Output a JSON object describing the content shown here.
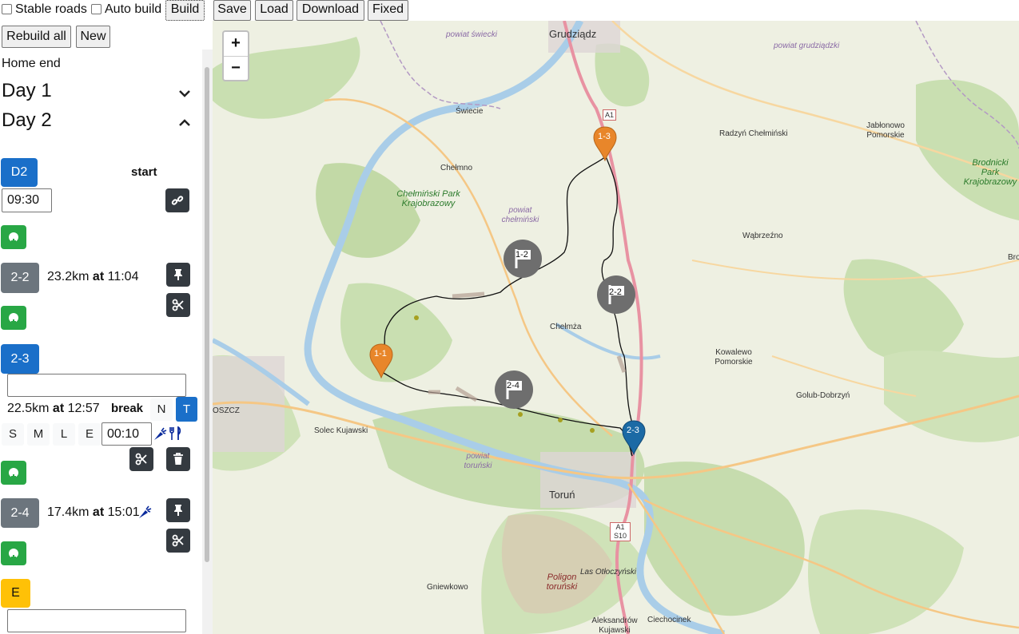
{
  "toolbar": {
    "stable_roads_label": "Stable roads",
    "auto_build_label": "Auto build",
    "build_label": "Build",
    "save_label": "Save",
    "load_label": "Load",
    "download_label": "Download",
    "fixed_label": "Fixed",
    "rebuild_all_label": "Rebuild all",
    "new_label": "New"
  },
  "sidebar": {
    "home_end": "Home end",
    "day1_title": "Day 1",
    "day2_title": "Day 2",
    "start": {
      "code": "D2",
      "label": "start",
      "time": "09:30"
    },
    "stops": [
      {
        "code": "2-2",
        "distance": "23.2km",
        "at": "at",
        "time": "11:04"
      },
      {
        "code": "2-3",
        "distance": "22.5km",
        "at": "at",
        "time": "12:57",
        "break_label": "break",
        "break_time": "00:10",
        "name_value": ""
      },
      {
        "code": "2-4",
        "distance": "17.4km",
        "at": "at",
        "time": "15:01"
      }
    ],
    "sizes": [
      "N",
      "T"
    ],
    "meal_sizes": [
      "S",
      "M",
      "L",
      "E"
    ],
    "end": {
      "code": "E",
      "name_value": ""
    }
  },
  "map": {
    "zoom_in": "+",
    "zoom_out": "−",
    "markers": [
      "1-3",
      "1-1",
      "2-3"
    ],
    "flags": [
      "1-2",
      "2-2",
      "2-4"
    ],
    "places": [
      "Grudziądz",
      "powiat świecki",
      "powiat grudziądzki",
      "Świecie",
      "A1",
      "Radzyń Chełmiński",
      "Jabłonowo Pomorskie",
      "Brodnicki Park Krajobrazowy",
      "Chełmno",
      "Chełmiński Park Krajobrazowy",
      "powiat chełmiński",
      "Wąbrzeźno",
      "Chełmża",
      "Kowalewo Pomorskie",
      "Golub-Dobrzyń",
      "OSZCZ",
      "Solec Kujawski",
      "powiat toruński",
      "Toruń",
      "A1 S10",
      "Poligon toruński",
      "Las Otłoczyński",
      "Gniewkowo",
      "Aleksandrów Kujawski",
      "Ciechocinek",
      "Bro"
    ]
  },
  "colors": {
    "primary": "#1a6fc9",
    "secondary": "#6c757d",
    "success": "#28a745",
    "dark": "#343a40",
    "warning": "#ffc107",
    "marker_orange": "#e8862a",
    "marker_blue": "#1b6aa5",
    "flag_grey": "#6e6e6e",
    "motorway": "#e892a2"
  }
}
